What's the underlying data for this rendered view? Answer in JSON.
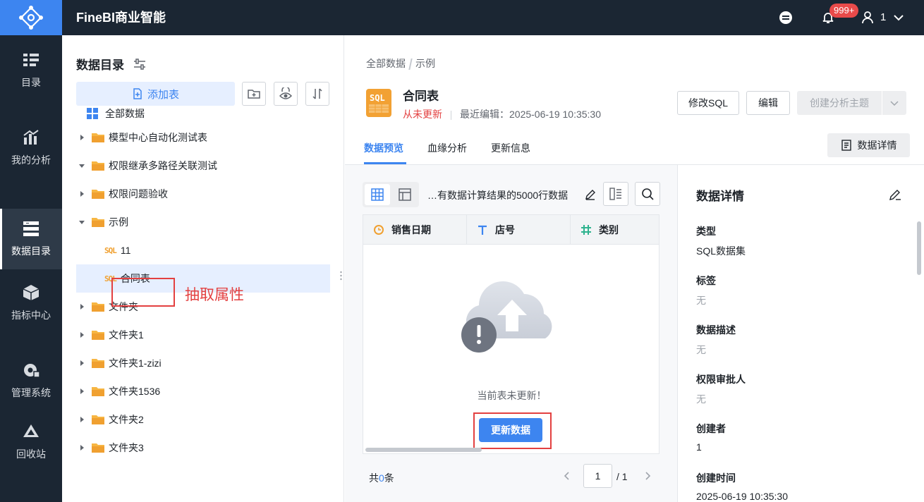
{
  "app": {
    "title": "FineBI商业智能",
    "badge": "999+",
    "user": "1"
  },
  "nav": [
    "目录",
    "我的分析",
    "数据目录",
    "指标中心",
    "管理系统",
    "回收站"
  ],
  "catalog": {
    "title": "数据目录",
    "add_label": "添加表",
    "tree": [
      {
        "label": "全部数据",
        "type": "root"
      },
      {
        "label": "模型中心自动化测试表",
        "type": "folder",
        "expanded": false
      },
      {
        "label": "权限继承多路径关联测试",
        "type": "folder",
        "expanded": true
      },
      {
        "label": "权限问题验收",
        "type": "folder",
        "expanded": false
      },
      {
        "label": "示例",
        "type": "folder",
        "expanded": true
      },
      {
        "label": "11",
        "type": "sql"
      },
      {
        "label": "合同表",
        "type": "sql",
        "selected": true
      },
      {
        "label": "文件夹",
        "type": "folder",
        "expanded": false
      },
      {
        "label": "文件夹1",
        "type": "folder",
        "expanded": false
      },
      {
        "label": "文件夹1-zizi",
        "type": "folder",
        "expanded": false
      },
      {
        "label": "文件夹1536",
        "type": "folder",
        "expanded": false
      },
      {
        "label": "文件夹2",
        "type": "folder",
        "expanded": false
      },
      {
        "label": "文件夹3",
        "type": "folder",
        "expanded": false
      }
    ],
    "annotation": "抽取属性"
  },
  "main": {
    "breadcrumb": [
      "全部数据",
      "示例"
    ],
    "table_name": "合同表",
    "status": "从未更新",
    "last_edit": "最近编辑：2025-06-19 10:35:30",
    "buttons": {
      "edit_sql": "修改SQL",
      "edit": "编辑",
      "create_theme": "创建分析主题"
    },
    "tabs": [
      "数据预览",
      "血缘分析",
      "更新信息"
    ],
    "detail_button": "数据详情",
    "note": "…有数据计算结果的5000行数据",
    "columns": [
      {
        "name": "销售日期",
        "kind": "date"
      },
      {
        "name": "店号",
        "kind": "text"
      },
      {
        "name": "类别",
        "kind": "number"
      }
    ],
    "empty_text": "当前表未更新！",
    "refresh_label": "更新数据",
    "total_prefix": "共",
    "total_count": "0",
    "total_suffix": "条",
    "page_current": "1",
    "page_total": "/ 1"
  },
  "details": {
    "title": "数据详情",
    "fields": [
      {
        "label": "类型",
        "value": "SQL数据集",
        "muted": false
      },
      {
        "label": "标签",
        "value": "无",
        "muted": true
      },
      {
        "label": "数据描述",
        "value": "无",
        "muted": true
      },
      {
        "label": "权限审批人",
        "value": "无",
        "muted": true
      },
      {
        "label": "创建者",
        "value": "1",
        "muted": false
      },
      {
        "label": "创建时间",
        "value": "2025-06-19 10:35:30",
        "muted": false
      }
    ]
  },
  "colors": {
    "accent": "#3d85f0",
    "warn": "#e34040",
    "folder": "#f0a030",
    "nav_bg": "#1b2633"
  }
}
